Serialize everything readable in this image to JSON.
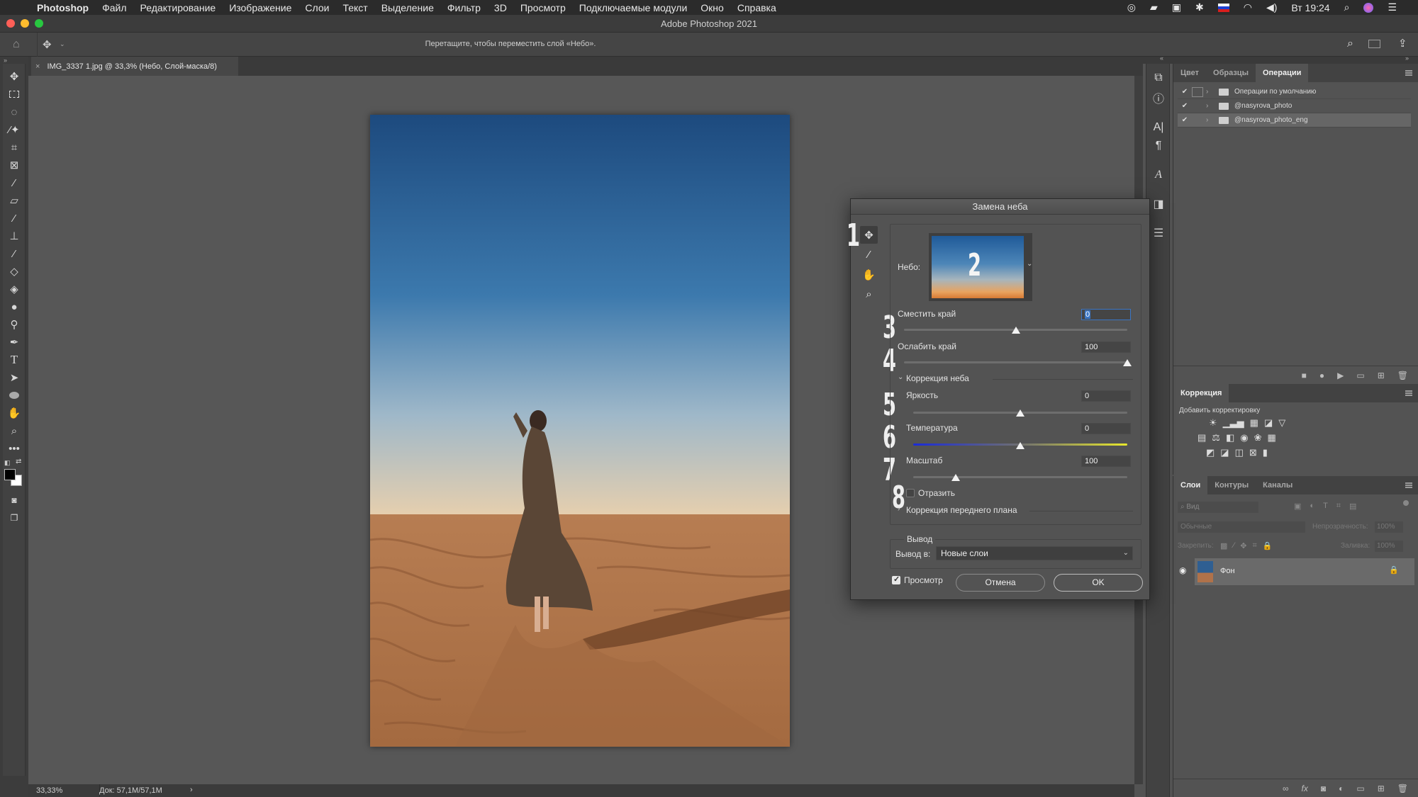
{
  "menubar": {
    "app": "Photoshop",
    "items": [
      "Файл",
      "Редактирование",
      "Изображение",
      "Слои",
      "Текст",
      "Выделение",
      "Фильтр",
      "3D",
      "Просмотр",
      "Подключаемые модули",
      "Окно",
      "Справка"
    ],
    "clock": "Вт 19:24",
    "status_icons": [
      "creative-cloud-icon",
      "screens-icon",
      "camera-icon",
      "bluetooth-icon",
      "ru-flag-icon",
      "wifi-icon",
      "volume-icon",
      "spotlight-icon",
      "siri-icon",
      "control-center-icon"
    ]
  },
  "window": {
    "title": "Adobe Photoshop 2021",
    "traffic_lights": {
      "close": "#ff5f57",
      "minimize": "#febc2e",
      "zoom": "#28c840"
    }
  },
  "options_bar": {
    "hint": "Перетащите, чтобы переместить слой «Небо».",
    "tool": "move-tool"
  },
  "document": {
    "tab_title": "IMG_3337 1.jpg @ 33,3% (Небо, Слой-маска/8)",
    "zoom": "33,33%",
    "doc_size": "Док: 57,1M/57,1M"
  },
  "toolbar": {
    "tools": [
      "move",
      "marquee",
      "lasso",
      "magic-wand",
      "crop",
      "frame",
      "eyedropper",
      "healing-brush",
      "brush",
      "clone-stamp",
      "history-brush",
      "eraser",
      "paint-bucket",
      "blur",
      "dodge",
      "pen",
      "type",
      "path-selection",
      "ellipse",
      "hand",
      "zoom",
      "more"
    ],
    "foreground_color": "#000000",
    "background_color": "#ffffff"
  },
  "actions_panel": {
    "tabs": [
      "Цвет",
      "Образцы",
      "Операции"
    ],
    "active_tab": "Операции",
    "items": [
      {
        "label": "Операции по умолчанию",
        "checked": true
      },
      {
        "label": "@nasyrova_photo",
        "checked": true
      },
      {
        "label": "@nasyrova_photo_eng",
        "checked": true,
        "selected": true
      }
    ]
  },
  "adjustments_panel": {
    "tab": "Коррекция",
    "subtitle": "Добавить корректировку"
  },
  "layers_panel": {
    "tabs": [
      "Слои",
      "Контуры",
      "Каналы"
    ],
    "active_tab": "Слои",
    "filter_placeholder": "Вид",
    "blend_mode": "Обычные",
    "opacity_label": "Непрозрачность:",
    "opacity": "100%",
    "lock_label": "Закрепить:",
    "fill_label": "Заливка:",
    "fill": "100%",
    "layers": [
      {
        "name": "Фон",
        "visible": true,
        "locked": true
      }
    ]
  },
  "dialog": {
    "title": "Замена неба",
    "sky_label": "Небо:",
    "annotations": [
      "1",
      "2",
      "3",
      "4",
      "5",
      "6",
      "7",
      "8"
    ],
    "shift_edge": {
      "label": "Сместить край",
      "value": "0",
      "min": -100,
      "max": 100
    },
    "fade_edge": {
      "label": "Ослабить край",
      "value": "100",
      "min": 0,
      "max": 100
    },
    "sky_adjust_section": "Коррекция неба",
    "brightness": {
      "label": "Яркость",
      "value": "0",
      "min": -100,
      "max": 100
    },
    "temperature": {
      "label": "Температура",
      "value": "0",
      "min": -100,
      "max": 100
    },
    "scale": {
      "label": "Масштаб",
      "value": "100",
      "min": 25,
      "max": 400
    },
    "flip": {
      "label": "Отразить",
      "checked": false
    },
    "foreground_section": "Коррекция переднего плана",
    "output_section": "Вывод",
    "output_to_label": "Вывод в:",
    "output_to": "Новые слои",
    "preview": {
      "label": "Просмотр",
      "checked": true
    },
    "cancel": "Отмена",
    "ok": "OK"
  }
}
